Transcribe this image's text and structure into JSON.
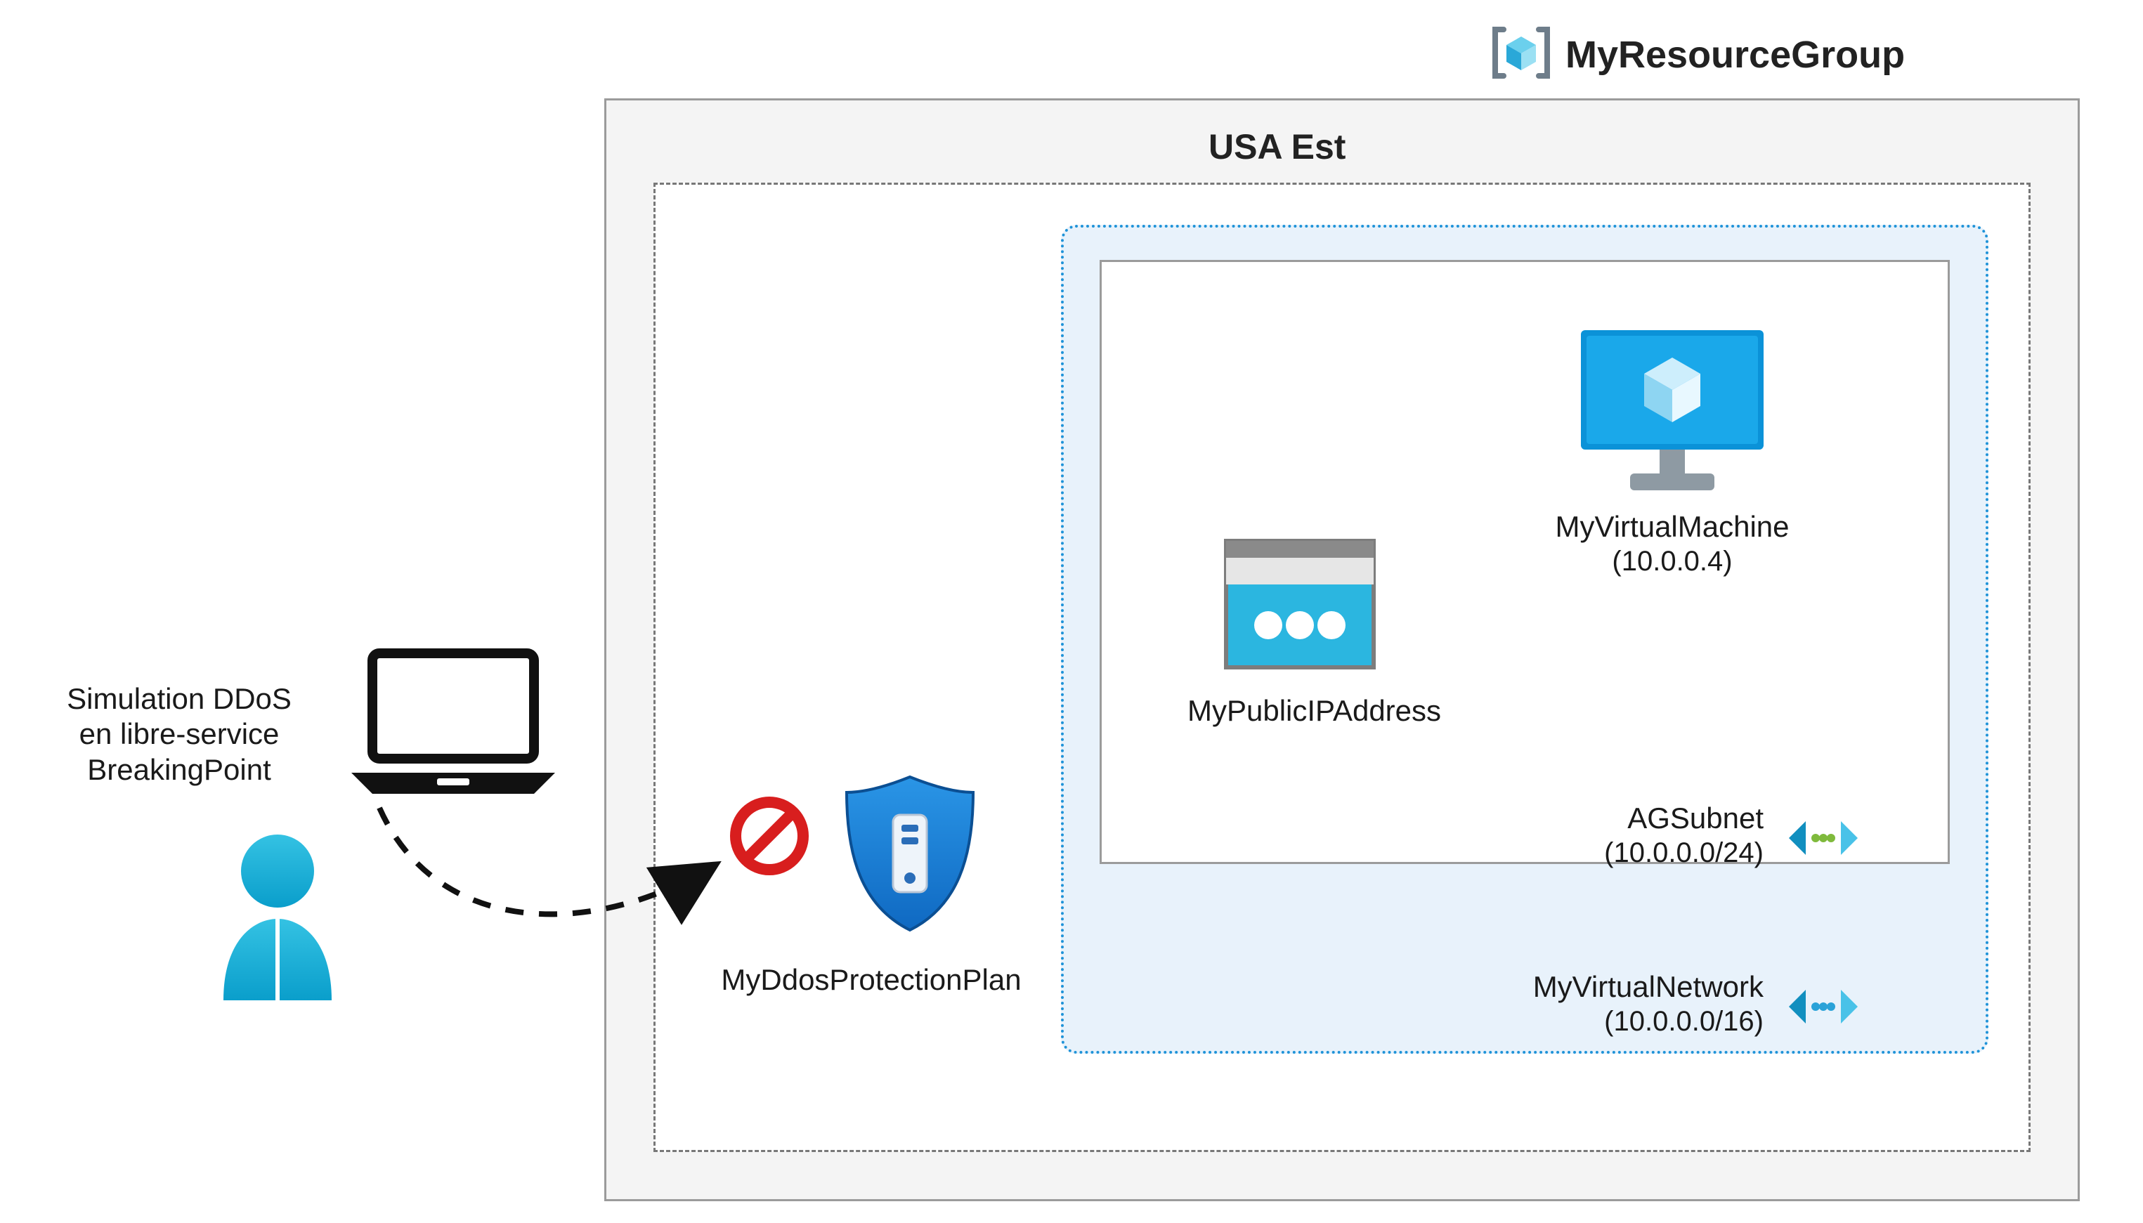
{
  "resource_group": {
    "title": "MyResourceGroup"
  },
  "region": {
    "title": "USA Est"
  },
  "vnet": {
    "name": "MyVirtualNetwork",
    "cidr": "(10.0.0.0/16)"
  },
  "subnet": {
    "name": "AGSubnet",
    "cidr": "(10.0.0.0/24)"
  },
  "public_ip": {
    "name": "MyPublicIPAddress"
  },
  "vm": {
    "name": "MyVirtualMachine",
    "ip": "(10.0.0.4)"
  },
  "ddos": {
    "name": "MyDdosProtectionPlan"
  },
  "client": {
    "line1": "Simulation DDoS",
    "line2": "en libre-service",
    "line3": "BreakingPoint"
  }
}
